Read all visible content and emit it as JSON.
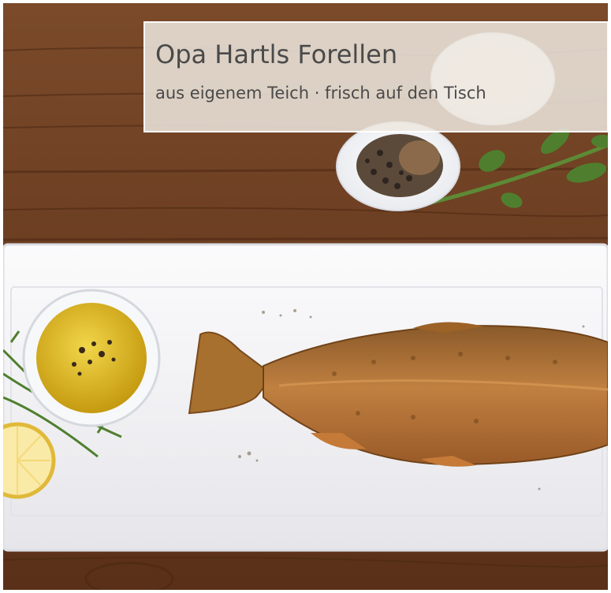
{
  "caption": {
    "title": "Opa Hartls Forellen",
    "subtitle": "aus eigenem Teich · frisch auf den Tisch"
  },
  "photo": {
    "subject": "pan-fried-trout-on-white-platter",
    "colors": {
      "wood": "#6b3f22",
      "platter": "#f4f4f6",
      "fish": "#b3742f",
      "oil": "#d9b21a",
      "lemon": "#f3d77a",
      "herbs": "#4f7f2e",
      "caption_text": "#4a4a4a"
    }
  }
}
